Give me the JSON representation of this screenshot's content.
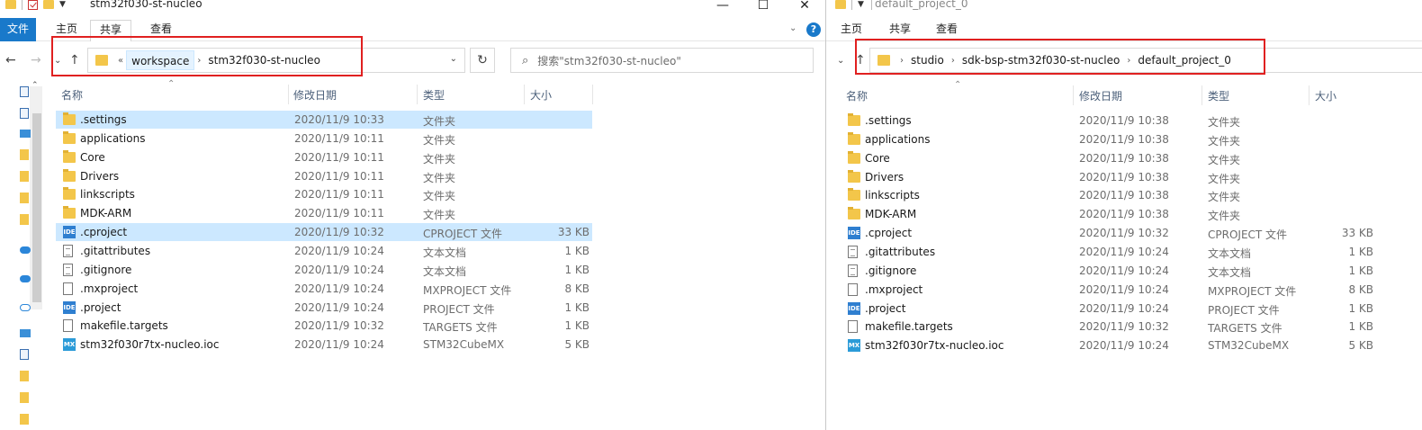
{
  "left": {
    "title": "stm32f030-st-nucleo",
    "window_controls": {
      "minimize": "—",
      "maximize": "☐",
      "close": "✕"
    },
    "ribbon": {
      "file": "文件",
      "home": "主页",
      "share": "共享",
      "view": "查看",
      "help": "?"
    },
    "breadcrumb": {
      "overflow": "«",
      "items": [
        "workspace",
        "stm32f030-st-nucleo"
      ]
    },
    "search": {
      "placeholder": "搜索\"stm32f030-st-nucleo\""
    },
    "columns": {
      "name": "名称",
      "modified": "修改日期",
      "type": "类型",
      "size": "大小"
    },
    "files": [
      {
        "name": ".settings",
        "date": "2020/11/9 10:33",
        "type": "文件夹",
        "size": "",
        "icon": "folder",
        "selected": true
      },
      {
        "name": "applications",
        "date": "2020/11/9 10:11",
        "type": "文件夹",
        "size": "",
        "icon": "folder"
      },
      {
        "name": "Core",
        "date": "2020/11/9 10:11",
        "type": "文件夹",
        "size": "",
        "icon": "folder"
      },
      {
        "name": "Drivers",
        "date": "2020/11/9 10:11",
        "type": "文件夹",
        "size": "",
        "icon": "folder"
      },
      {
        "name": "linkscripts",
        "date": "2020/11/9 10:11",
        "type": "文件夹",
        "size": "",
        "icon": "folder"
      },
      {
        "name": "MDK-ARM",
        "date": "2020/11/9 10:11",
        "type": "文件夹",
        "size": "",
        "icon": "folder"
      },
      {
        "name": ".cproject",
        "date": "2020/11/9 10:32",
        "type": "CPROJECT 文件",
        "size": "33 KB",
        "icon": "ide",
        "selected": true
      },
      {
        "name": ".gitattributes",
        "date": "2020/11/9 10:24",
        "type": "文本文档",
        "size": "1 KB",
        "icon": "text"
      },
      {
        "name": ".gitignore",
        "date": "2020/11/9 10:24",
        "type": "文本文档",
        "size": "1 KB",
        "icon": "text"
      },
      {
        "name": ".mxproject",
        "date": "2020/11/9 10:24",
        "type": "MXPROJECT 文件",
        "size": "8 KB",
        "icon": "blank"
      },
      {
        "name": ".project",
        "date": "2020/11/9 10:24",
        "type": "PROJECT 文件",
        "size": "1 KB",
        "icon": "ide"
      },
      {
        "name": "makefile.targets",
        "date": "2020/11/9 10:32",
        "type": "TARGETS 文件",
        "size": "1 KB",
        "icon": "blank"
      },
      {
        "name": "stm32f030r7tx-nucleo.ioc",
        "date": "2020/11/9 10:24",
        "type": "STM32CubeMX",
        "size": "5 KB",
        "icon": "mx"
      }
    ]
  },
  "right": {
    "title": "default_project_0",
    "ribbon": {
      "home": "主页",
      "share": "共享",
      "view": "查看"
    },
    "breadcrumb": {
      "items": [
        "studio",
        "sdk-bsp-stm32f030-st-nucleo",
        "default_project_0"
      ]
    },
    "columns": {
      "name": "名称",
      "modified": "修改日期",
      "type": "类型",
      "size": "大小"
    },
    "files": [
      {
        "name": ".settings",
        "date": "2020/11/9 10:38",
        "type": "文件夹",
        "size": "",
        "icon": "folder"
      },
      {
        "name": "applications",
        "date": "2020/11/9 10:38",
        "type": "文件夹",
        "size": "",
        "icon": "folder"
      },
      {
        "name": "Core",
        "date": "2020/11/9 10:38",
        "type": "文件夹",
        "size": "",
        "icon": "folder"
      },
      {
        "name": "Drivers",
        "date": "2020/11/9 10:38",
        "type": "文件夹",
        "size": "",
        "icon": "folder"
      },
      {
        "name": "linkscripts",
        "date": "2020/11/9 10:38",
        "type": "文件夹",
        "size": "",
        "icon": "folder"
      },
      {
        "name": "MDK-ARM",
        "date": "2020/11/9 10:38",
        "type": "文件夹",
        "size": "",
        "icon": "folder"
      },
      {
        "name": ".cproject",
        "date": "2020/11/9 10:32",
        "type": "CPROJECT 文件",
        "size": "33 KB",
        "icon": "ide"
      },
      {
        "name": ".gitattributes",
        "date": "2020/11/9 10:24",
        "type": "文本文档",
        "size": "1 KB",
        "icon": "text"
      },
      {
        "name": ".gitignore",
        "date": "2020/11/9 10:24",
        "type": "文本文档",
        "size": "1 KB",
        "icon": "text"
      },
      {
        "name": ".mxproject",
        "date": "2020/11/9 10:24",
        "type": "MXPROJECT 文件",
        "size": "8 KB",
        "icon": "blank"
      },
      {
        "name": ".project",
        "date": "2020/11/9 10:24",
        "type": "PROJECT 文件",
        "size": "1 KB",
        "icon": "ide"
      },
      {
        "name": "makefile.targets",
        "date": "2020/11/9 10:32",
        "type": "TARGETS 文件",
        "size": "1 KB",
        "icon": "blank"
      },
      {
        "name": "stm32f030r7tx-nucleo.ioc",
        "date": "2020/11/9 10:24",
        "type": "STM32CubeMX",
        "size": "5 KB",
        "icon": "mx"
      }
    ]
  },
  "icon_labels": {
    "ide": "IDE",
    "mx": "MX"
  },
  "colors": {
    "accent": "#1979ca",
    "selection": "#cce8ff",
    "folder": "#f3c64a",
    "annotation": "#e02020"
  }
}
